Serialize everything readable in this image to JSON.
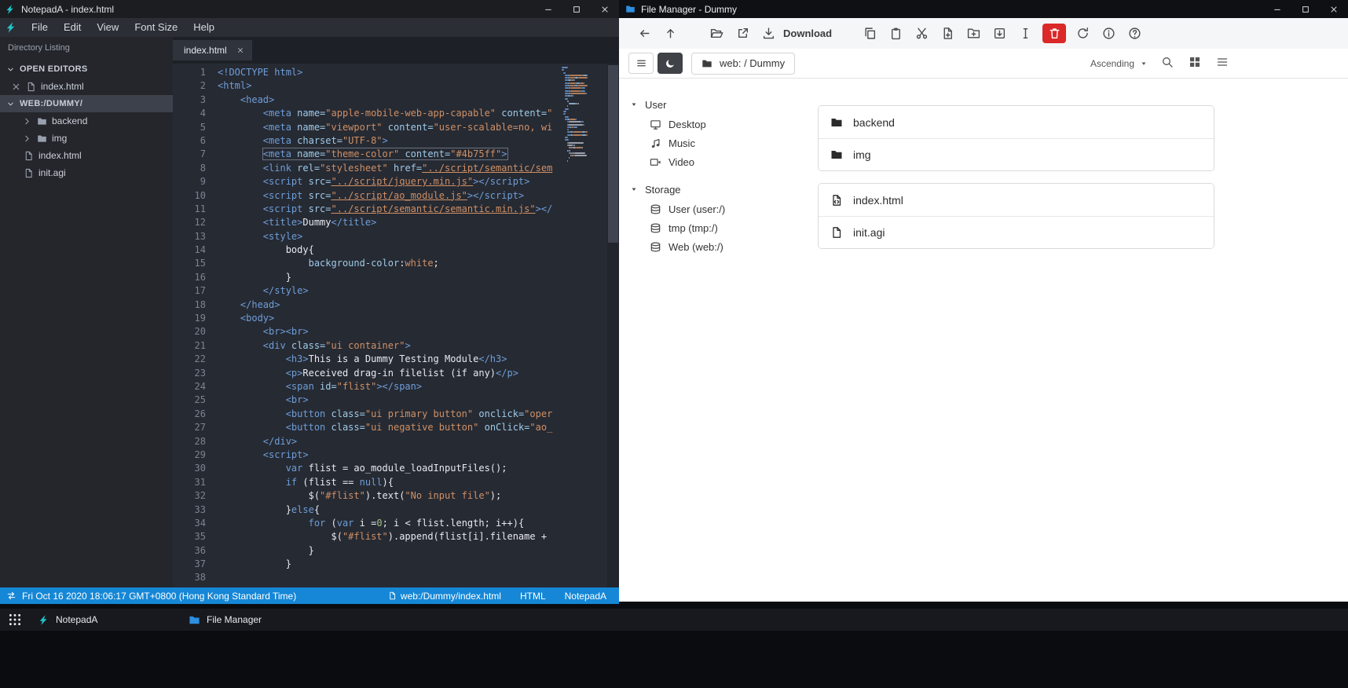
{
  "desktop": {
    "taskbar": {
      "items": [
        {
          "label": "NotepadA",
          "icon": "notepada-logo"
        },
        {
          "label": "File Manager",
          "icon": "filemanager-logo"
        }
      ]
    }
  },
  "notepada": {
    "titlebar": {
      "title": "NotepadA - index.html"
    },
    "menus": [
      "File",
      "Edit",
      "View",
      "Font Size",
      "Help"
    ],
    "sidebar": {
      "header": "Directory Listing",
      "tree": [
        {
          "label": "OPEN EDITORS",
          "type": "section",
          "icons": [
            "chevron-down"
          ]
        },
        {
          "label": "index.html",
          "type": "open-editor",
          "icons": [
            "close",
            "file"
          ]
        },
        {
          "label": "WEB:/DUMMY/",
          "type": "section",
          "selected": true,
          "icons": [
            "chevron-down"
          ]
        },
        {
          "label": "backend",
          "type": "folder",
          "icons": [
            "chevron-right",
            "folder"
          ]
        },
        {
          "label": "img",
          "type": "folder",
          "icons": [
            "chevron-right",
            "folder"
          ]
        },
        {
          "label": "index.html",
          "type": "file",
          "icons": [
            "file"
          ]
        },
        {
          "label": "init.agi",
          "type": "file",
          "icons": [
            "file"
          ]
        }
      ]
    },
    "tabs": [
      {
        "label": "index.html",
        "active": true
      }
    ],
    "editor": {
      "active_line": 7,
      "lines": [
        [
          [
            "t",
            "<!DOCTYPE html>"
          ]
        ],
        [
          [
            "t",
            "<html>"
          ]
        ],
        [
          [
            "t",
            "    <head>"
          ]
        ],
        [
          [
            "t",
            "        <meta "
          ],
          [
            "a",
            "name="
          ],
          [
            "s",
            "\"apple-mobile-web-app-capable\""
          ],
          [
            "d",
            " "
          ],
          [
            "a",
            "content="
          ],
          [
            "s",
            "\""
          ]
        ],
        [
          [
            "t",
            "        <meta "
          ],
          [
            "a",
            "name="
          ],
          [
            "s",
            "\"viewport\""
          ],
          [
            "d",
            " "
          ],
          [
            "a",
            "content="
          ],
          [
            "s",
            "\"user-scalable=no, wi"
          ]
        ],
        [
          [
            "t",
            "        <meta "
          ],
          [
            "a",
            "charset="
          ],
          [
            "s",
            "\"UTF-8\""
          ],
          [
            "t",
            ">"
          ]
        ],
        [
          [
            "d",
            "        "
          ],
          [
            "t",
            "<meta "
          ],
          [
            "a",
            "name="
          ],
          [
            "s",
            "\"theme-color\""
          ],
          [
            "d",
            " "
          ],
          [
            "a",
            "content="
          ],
          [
            "s",
            "\"#4b75ff\""
          ],
          [
            "t",
            ">"
          ]
        ],
        [
          [
            "t",
            "        <link "
          ],
          [
            "a",
            "rel="
          ],
          [
            "s",
            "\"stylesheet\""
          ],
          [
            "d",
            " "
          ],
          [
            "a",
            "href="
          ],
          [
            "u",
            "\"../script/semantic/sem"
          ]
        ],
        [
          [
            "t",
            "        <script "
          ],
          [
            "a",
            "src="
          ],
          [
            "u",
            "\"../script/jquery.min.js\""
          ],
          [
            "t",
            "></script>"
          ]
        ],
        [
          [
            "t",
            "        <script "
          ],
          [
            "a",
            "src="
          ],
          [
            "u",
            "\"../script/ao_module.js\""
          ],
          [
            "t",
            "></script>"
          ]
        ],
        [
          [
            "t",
            "        <script "
          ],
          [
            "a",
            "src="
          ],
          [
            "u",
            "\"../script/semantic/semantic.min.js\""
          ],
          [
            "t",
            "></"
          ]
        ],
        [
          [
            "t",
            "        <title>"
          ],
          [
            "d",
            "Dummy"
          ],
          [
            "t",
            "</title>"
          ]
        ],
        [
          [
            "t",
            "        <style>"
          ]
        ],
        [
          [
            "d",
            "            body{"
          ]
        ],
        [
          [
            "a",
            "                background-color"
          ],
          [
            "d",
            ":"
          ],
          [
            "s",
            "white"
          ],
          [
            "d",
            ";"
          ]
        ],
        [
          [
            "d",
            "            }"
          ]
        ],
        [
          [
            "t",
            "        </style>"
          ]
        ],
        [
          [
            "t",
            "    </head>"
          ]
        ],
        [
          [
            "t",
            "    <body>"
          ]
        ],
        [
          [
            "t",
            "        <br><br>"
          ]
        ],
        [
          [
            "t",
            "        <div "
          ],
          [
            "a",
            "class="
          ],
          [
            "s",
            "\"ui container\""
          ],
          [
            "t",
            ">"
          ]
        ],
        [
          [
            "t",
            "            <h3>"
          ],
          [
            "d",
            "This is a Dummy Testing Module"
          ],
          [
            "t",
            "</h3>"
          ]
        ],
        [
          [
            "t",
            "            <p>"
          ],
          [
            "d",
            "Received drag-in filelist (if any)"
          ],
          [
            "t",
            "</p>"
          ]
        ],
        [
          [
            "t",
            "            <span "
          ],
          [
            "a",
            "id="
          ],
          [
            "s",
            "\"flist\""
          ],
          [
            "t",
            "></span>"
          ]
        ],
        [
          [
            "t",
            "            <br>"
          ]
        ],
        [
          [
            "t",
            "            <button "
          ],
          [
            "a",
            "class="
          ],
          [
            "s",
            "\"ui primary button\""
          ],
          [
            "d",
            " "
          ],
          [
            "a",
            "onclick="
          ],
          [
            "s",
            "\"oper"
          ]
        ],
        [
          [
            "t",
            "            <button "
          ],
          [
            "a",
            "class="
          ],
          [
            "s",
            "\"ui negative button\""
          ],
          [
            "d",
            " "
          ],
          [
            "a",
            "onClick="
          ],
          [
            "s",
            "\"ao_"
          ]
        ],
        [
          [
            "t",
            "        </div>"
          ]
        ],
        [
          [
            "t",
            "        <script>"
          ]
        ],
        [
          [
            "d",
            "            "
          ],
          [
            "k",
            "var"
          ],
          [
            "d",
            " flist = ao_module_loadInputFiles();"
          ]
        ],
        [
          [
            "d",
            "            "
          ],
          [
            "k",
            "if"
          ],
          [
            "d",
            " (flist == "
          ],
          [
            "k",
            "null"
          ],
          [
            "d",
            "){"
          ]
        ],
        [
          [
            "d",
            "                $("
          ],
          [
            "s",
            "\"#flist\""
          ],
          [
            "d",
            ").text("
          ],
          [
            "s",
            "\"No input file\""
          ],
          [
            "d",
            ");"
          ]
        ],
        [
          [
            "d",
            "            }"
          ],
          [
            "k",
            "else"
          ],
          [
            "d",
            "{"
          ]
        ],
        [
          [
            "d",
            "                "
          ],
          [
            "k",
            "for"
          ],
          [
            "d",
            " ("
          ],
          [
            "k",
            "var"
          ],
          [
            "d",
            " i ="
          ],
          [
            "n",
            "0"
          ],
          [
            "d",
            "; i < flist.length; i++){"
          ]
        ],
        [
          [
            "d",
            "                    $("
          ],
          [
            "s",
            "\"#flist\""
          ],
          [
            "d",
            ").append(flist[i].filename + "
          ]
        ],
        [
          [
            "d",
            "                }"
          ]
        ],
        [
          [
            "d",
            "            }"
          ]
        ],
        [
          [
            "d",
            ""
          ]
        ],
        [
          [
            "d",
            ""
          ]
        ]
      ]
    },
    "statusbar": {
      "datetime": "Fri Oct 16 2020 18:06:17 GMT+0800 (Hong Kong Standard Time)",
      "path": "web:/Dummy/index.html",
      "language": "HTML",
      "app": "NotepadA"
    }
  },
  "filemanager": {
    "titlebar": {
      "title": "File Manager - Dummy"
    },
    "toolbar": {
      "download_label": "Download",
      "groups": [
        [
          "back",
          "up"
        ],
        [
          "folder-open",
          "open-external",
          "download"
        ],
        [
          "copy",
          "paste",
          "cut",
          "new-file",
          "new-folder",
          "import",
          "rename",
          "delete",
          "refresh",
          "info",
          "help"
        ]
      ]
    },
    "pathbar": {
      "breadcrumb": "web: / Dummy",
      "sort": "Ascending"
    },
    "sidebar": {
      "sections": [
        {
          "label": "User",
          "items": [
            {
              "label": "Desktop",
              "icon": "desktop"
            },
            {
              "label": "Music",
              "icon": "music"
            },
            {
              "label": "Video",
              "icon": "video"
            }
          ]
        },
        {
          "label": "Storage",
          "items": [
            {
              "label": "User (user:/)",
              "icon": "drive"
            },
            {
              "label": "tmp (tmp:/)",
              "icon": "drive"
            },
            {
              "label": "Web (web:/)",
              "icon": "drive"
            }
          ]
        }
      ]
    },
    "files": {
      "groups": [
        [
          {
            "name": "backend",
            "icon": "folder"
          },
          {
            "name": "img",
            "icon": "folder"
          }
        ],
        [
          {
            "name": "index.html",
            "icon": "file-code"
          },
          {
            "name": "init.agi",
            "icon": "file"
          }
        ]
      ]
    }
  }
}
